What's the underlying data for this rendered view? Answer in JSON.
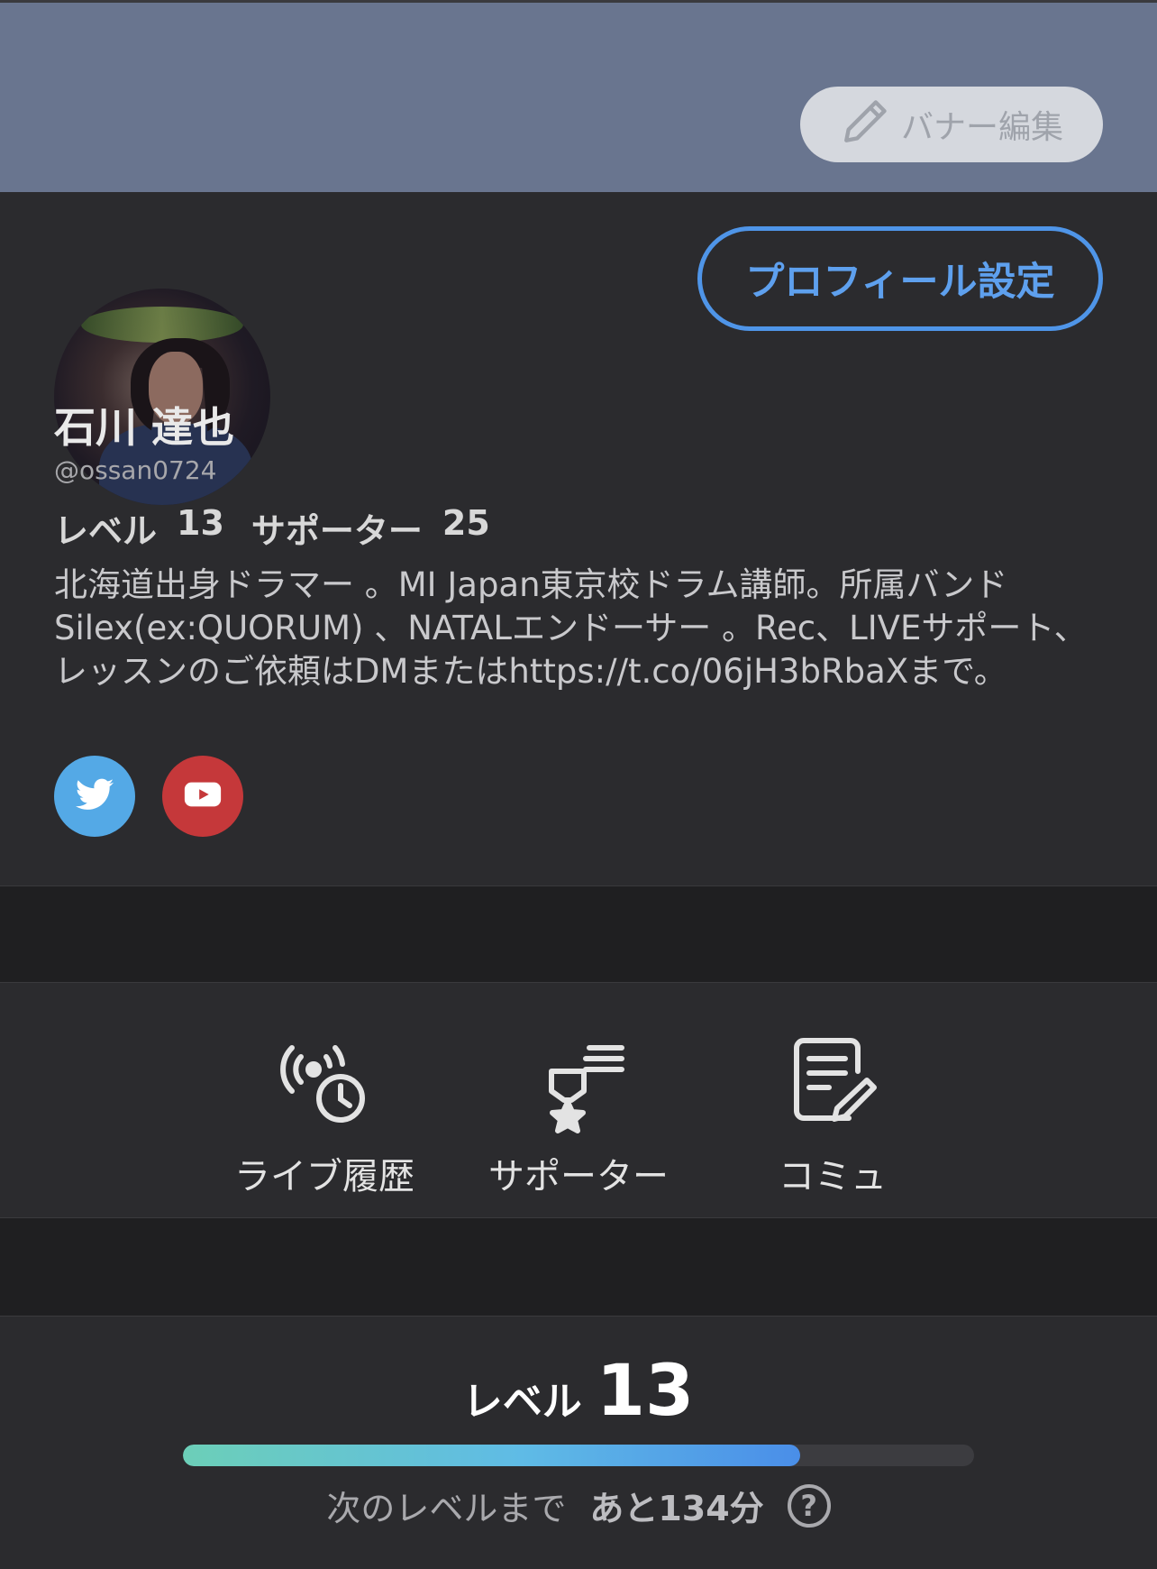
{
  "banner": {
    "edit_label": "バナー編集",
    "edit_icon": "pencil-icon"
  },
  "profile": {
    "settings_label": "プロフィール設定",
    "name": "石川 達也",
    "handle": "@ossan0724",
    "level_label": "レベル",
    "level_value": "13",
    "supporter_label": "サポーター",
    "supporter_value": "25",
    "bio": "北海道出身ドラマー 。MI Japan東京校ドラム講師。所属バンドSilex(ex:QUORUM) 、NATALエンドーサー 。Rec、LIVEサポート、レッスンのご依頼はDMまたはhttps://t.co/06jH3bRbaXまで。",
    "socials": [
      {
        "icon": "twitter-icon",
        "color": "#54a9e6"
      },
      {
        "icon": "youtube-icon",
        "color": "#c5383a"
      }
    ]
  },
  "menu": [
    {
      "label": "ライブ履歴",
      "icon": "live-history-icon"
    },
    {
      "label": "サポーター",
      "icon": "supporter-icon"
    },
    {
      "label": "コミュ",
      "icon": "community-icon"
    }
  ],
  "level": {
    "label": "レベル",
    "value": "13",
    "progress_fraction": 0.78,
    "next_label": "次のレベルまで",
    "remaining": "あと134分",
    "help_symbol": "?"
  },
  "colors": {
    "banner": "#69758f",
    "accent_blue": "#4f95e8",
    "background": "#2b2b2e",
    "separator": "#1f1f21"
  }
}
